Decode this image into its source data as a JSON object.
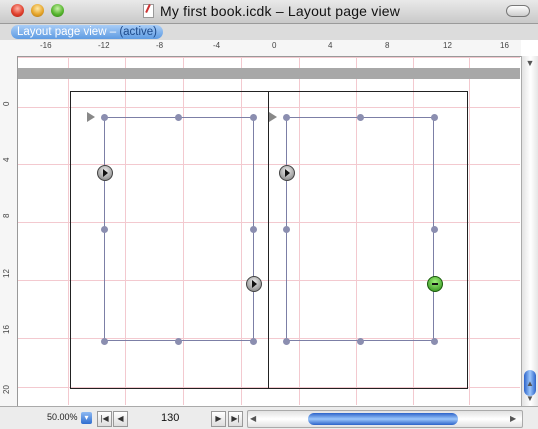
{
  "window": {
    "title": "My first book.icdk – Layout page view"
  },
  "tab": {
    "label": "Layout page view –",
    "status": "(active)"
  },
  "ruler": {
    "horizontal_labels": [
      "-16",
      "-12",
      "-8",
      "-4",
      "0",
      "4",
      "8",
      "12",
      "16"
    ],
    "vertical_labels": [
      "0",
      "4",
      "8",
      "12",
      "16",
      "20"
    ]
  },
  "statusbar": {
    "zoom": "50.00%",
    "zoom_popup_glyph": "▾",
    "first_label": "|◀",
    "prev_label": "◀",
    "page_number": "130",
    "next_label": "▶",
    "last_label": "▶|"
  },
  "scroll": {
    "up_arrow": "▼",
    "down_arrow": "▲",
    "left_arrow": "◀",
    "right_arrow": "▶"
  },
  "colors": {
    "accent": "#5e9be2",
    "grid": "#f3c9cf",
    "frame": "#7c7fa6"
  }
}
